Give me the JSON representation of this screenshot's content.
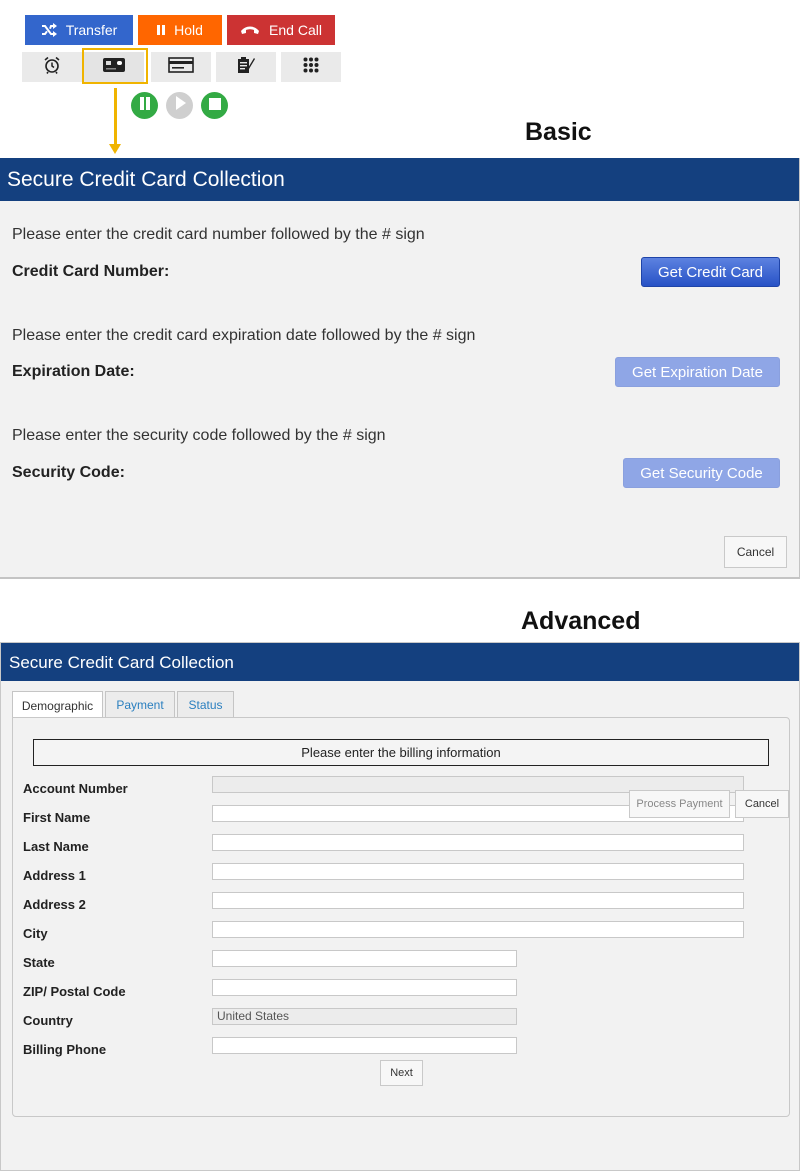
{
  "toolbar": {
    "transfer_label": "Transfer",
    "hold_label": "Hold",
    "end_call_label": "End Call"
  },
  "section_labels": {
    "basic": "Basic",
    "advanced": "Advanced"
  },
  "basic": {
    "title": "Secure Credit Card Collection",
    "card_prompt": "Please enter the credit card number followed by the # sign",
    "card_label": "Credit Card Number:",
    "card_button": "Get Credit Card",
    "exp_prompt": "Please enter the credit card expiration date followed by the # sign",
    "exp_label": "Expiration Date:",
    "exp_button": "Get Expiration Date",
    "sec_prompt": "Please enter the security code followed by the # sign",
    "sec_label": "Security Code:",
    "sec_button": "Get Security Code",
    "cancel": "Cancel"
  },
  "advanced": {
    "title": "Secure Credit Card Collection",
    "tabs": [
      "Demographic",
      "Payment",
      "Status"
    ],
    "banner": "Please enter the billing information",
    "fields": [
      {
        "label": "Account Number",
        "value": ""
      },
      {
        "label": "First Name",
        "value": ""
      },
      {
        "label": "Last Name",
        "value": ""
      },
      {
        "label": "Address 1",
        "value": ""
      },
      {
        "label": "Address 2",
        "value": ""
      },
      {
        "label": "City",
        "value": ""
      },
      {
        "label": "State",
        "value": ""
      },
      {
        "label": "ZIP/ Postal Code",
        "value": ""
      },
      {
        "label": "Country",
        "value": "United States"
      },
      {
        "label": "Billing Phone",
        "value": ""
      }
    ],
    "next": "Next",
    "process_payment": "Process Payment",
    "cancel": "Cancel"
  },
  "colors": {
    "header_blue": "#14407f",
    "transfer": "#3366cc",
    "hold": "#ff6600",
    "end_call": "#cc3333",
    "highlight": "#f0b400",
    "control_green": "#33aa44"
  }
}
